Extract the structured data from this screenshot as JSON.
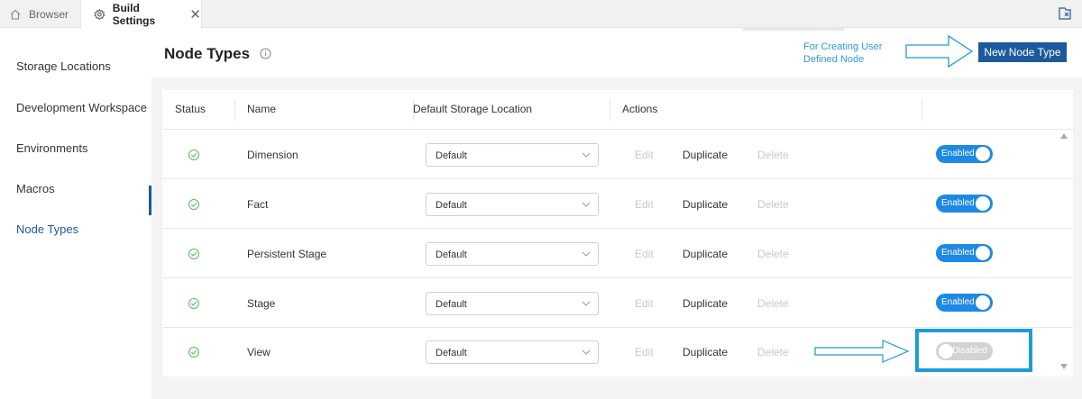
{
  "tabs": [
    {
      "label": "Browser",
      "icon": "home-icon",
      "active": false
    },
    {
      "label": "Build Settings",
      "icon": "gear-icon",
      "active": true
    }
  ],
  "sidebar": {
    "items": [
      {
        "label": "Storage Locations",
        "active": false
      },
      {
        "label": "Development Workspace",
        "active": false
      },
      {
        "label": "Environments",
        "active": false
      },
      {
        "label": "Macros",
        "active": false
      },
      {
        "label": "Node Types",
        "active": true
      }
    ]
  },
  "header": {
    "title": "Node Types",
    "annotation": "For Creating User Defined Node",
    "new_button": "New Node Type"
  },
  "table": {
    "columns": [
      "Status",
      "Name",
      "Default Storage Location",
      "Actions"
    ],
    "rows": [
      {
        "name": "Dimension",
        "storage": "Default",
        "edit": "Edit",
        "duplicate": "Duplicate",
        "delete": "Delete",
        "toggle": "Enabled",
        "enabled": true
      },
      {
        "name": "Fact",
        "storage": "Default",
        "edit": "Edit",
        "duplicate": "Duplicate",
        "delete": "Delete",
        "toggle": "Enabled",
        "enabled": true
      },
      {
        "name": "Persistent Stage",
        "storage": "Default",
        "edit": "Edit",
        "duplicate": "Duplicate",
        "delete": "Delete",
        "toggle": "Enabled",
        "enabled": true
      },
      {
        "name": "Stage",
        "storage": "Default",
        "edit": "Edit",
        "duplicate": "Duplicate",
        "delete": "Delete",
        "toggle": "Enabled",
        "enabled": true
      },
      {
        "name": "View",
        "storage": "Default",
        "edit": "Edit",
        "duplicate": "Duplicate",
        "delete": "Delete",
        "toggle": "Disabled",
        "enabled": false
      }
    ]
  },
  "colors": {
    "accent": "#1d5a9c",
    "toggle_on": "#1e88e5",
    "annotation": "#1e9ad6",
    "status_ok": "#5cb85c"
  }
}
